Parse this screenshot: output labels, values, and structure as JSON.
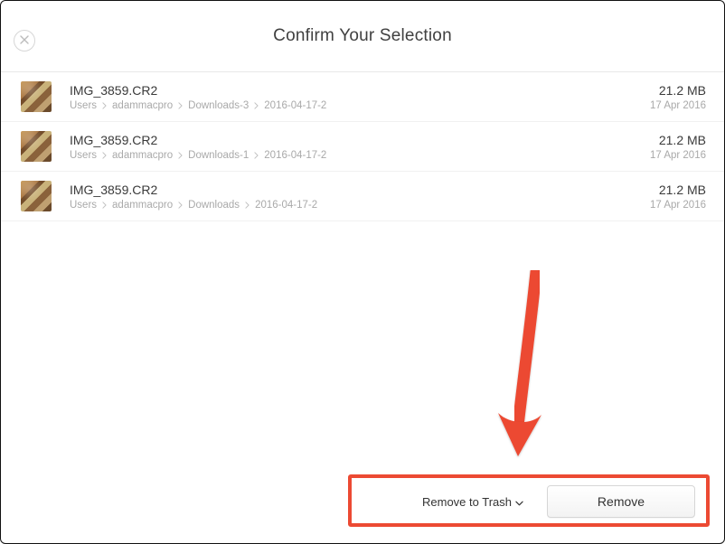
{
  "title": "Confirm Your Selection",
  "files": [
    {
      "name": "IMG_3859.CR2",
      "path": [
        "Users",
        "adammacpro",
        "Downloads-3",
        "2016-04-17-2"
      ],
      "size": "21.2 MB",
      "date": "17 Apr 2016"
    },
    {
      "name": "IMG_3859.CR2",
      "path": [
        "Users",
        "adammacpro",
        "Downloads-1",
        "2016-04-17-2"
      ],
      "size": "21.2 MB",
      "date": "17 Apr 2016"
    },
    {
      "name": "IMG_3859.CR2",
      "path": [
        "Users",
        "adammacpro",
        "Downloads",
        "2016-04-17-2"
      ],
      "size": "21.2 MB",
      "date": "17 Apr 2016"
    }
  ],
  "footer": {
    "dropdown_label": "Remove to Trash",
    "remove_label": "Remove"
  },
  "annotation": {
    "arrow_color": "#ec4a33",
    "box_color": "#ec4a33"
  }
}
